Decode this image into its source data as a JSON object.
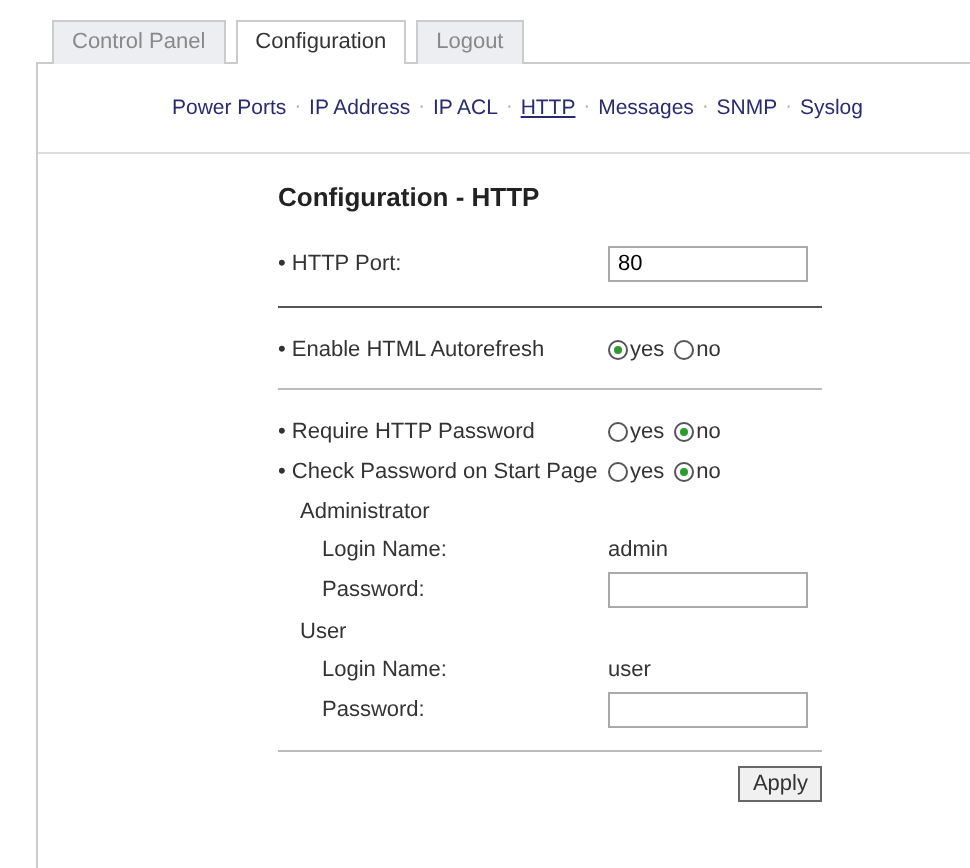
{
  "tabs": [
    {
      "label": "Control Panel",
      "selected": false
    },
    {
      "label": "Configuration",
      "selected": true
    },
    {
      "label": "Logout",
      "selected": false
    }
  ],
  "nav": {
    "separator": "·",
    "links": [
      {
        "label": "Power Ports",
        "selected": false
      },
      {
        "label": "IP Address",
        "selected": false
      },
      {
        "label": "IP ACL",
        "selected": false
      },
      {
        "label": "HTTP",
        "selected": true
      },
      {
        "label": "Messages",
        "selected": false
      },
      {
        "label": "SNMP",
        "selected": false
      },
      {
        "label": "Syslog",
        "selected": false
      }
    ]
  },
  "form": {
    "title": "Configuration - HTTP",
    "sections": [
      {
        "rows": [
          {
            "kind": "text",
            "label": "• HTTP Port:",
            "value": "80"
          }
        ]
      },
      {
        "rows": [
          {
            "kind": "radio",
            "label": "• Enable HTML Autorefresh",
            "options": [
              {
                "label": "yes",
                "selected": true
              },
              {
                "label": "no",
                "selected": false
              }
            ]
          }
        ]
      },
      {
        "rows": [
          {
            "kind": "radio",
            "label": "• Require HTTP Password",
            "options": [
              {
                "label": "yes",
                "selected": false
              },
              {
                "label": "no",
                "selected": true
              }
            ]
          },
          {
            "kind": "radio",
            "label": "• Check Password on Start Page",
            "options": [
              {
                "label": "yes",
                "selected": false
              },
              {
                "label": "no",
                "selected": true
              }
            ]
          },
          {
            "kind": "heading",
            "label": "Administrator"
          },
          {
            "kind": "static",
            "label": "Login Name:",
            "value": "admin"
          },
          {
            "kind": "password",
            "label": "Password:"
          },
          {
            "kind": "heading",
            "label": "User"
          },
          {
            "kind": "static",
            "label": "Login Name:",
            "value": "user"
          },
          {
            "kind": "password",
            "label": "Password:"
          }
        ]
      }
    ],
    "button": "Apply"
  }
}
